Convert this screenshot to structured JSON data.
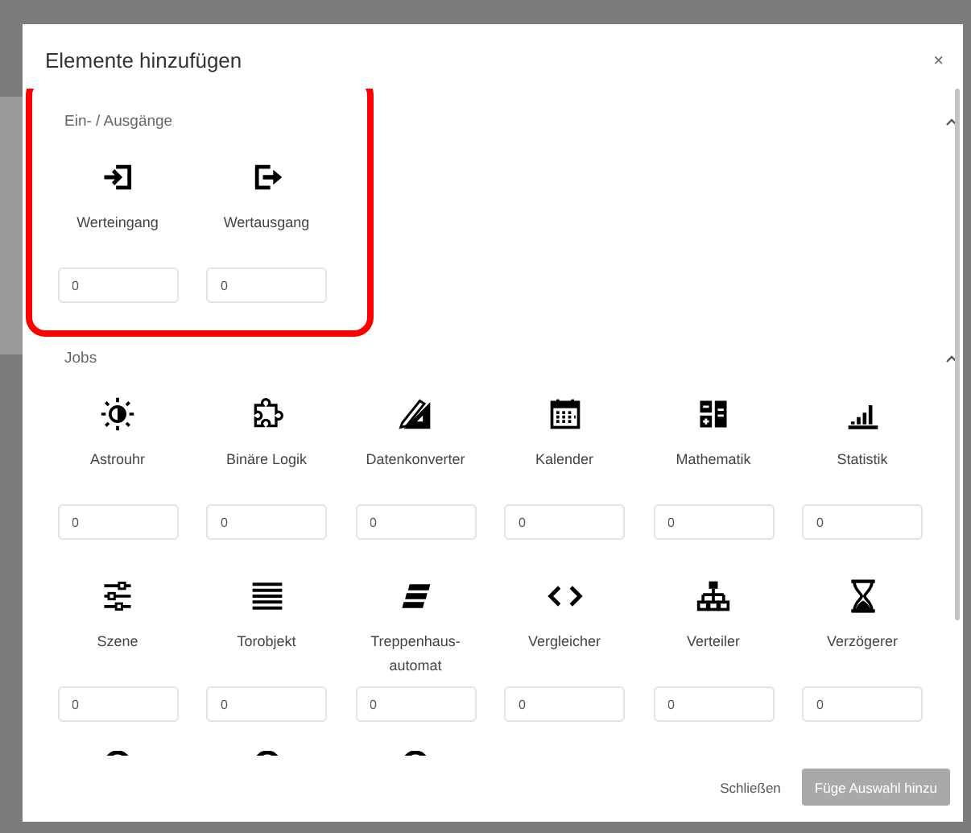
{
  "dialog": {
    "title": "Elemente hinzufügen",
    "close": "×"
  },
  "sections": [
    {
      "title": "Ein- / Ausgänge",
      "expanded": true,
      "highlighted": true,
      "items": [
        {
          "kind": "input",
          "label": "Werteingang",
          "value": "0"
        },
        {
          "kind": "output",
          "label": "Wertausgang",
          "value": "0"
        }
      ]
    },
    {
      "title": "Jobs",
      "expanded": true,
      "highlighted": false,
      "items": [
        {
          "kind": "sun",
          "label": "Astrouhr",
          "value": "0"
        },
        {
          "kind": "puzzle",
          "label": "Binäre Logik",
          "value": "0"
        },
        {
          "kind": "ruler",
          "label": "Datenkonverter",
          "value": "0"
        },
        {
          "kind": "calendar",
          "label": "Kalender",
          "value": "0"
        },
        {
          "kind": "calculator",
          "label": "Mathematik",
          "value": "0"
        },
        {
          "kind": "chart",
          "label": "Statistik",
          "value": "0"
        },
        {
          "kind": "sliders",
          "label": "Szene",
          "value": "0"
        },
        {
          "kind": "lines",
          "label": "Torobjekt",
          "value": "0"
        },
        {
          "kind": "stairs",
          "label": "Treppenhaus-automat",
          "value": "0"
        },
        {
          "kind": "code",
          "label": "Vergleicher",
          "value": "0"
        },
        {
          "kind": "tree",
          "label": "Verteiler",
          "value": "0"
        },
        {
          "kind": "hourglass",
          "label": "Verzögerer",
          "value": "0"
        },
        {
          "kind": "arc"
        },
        {
          "kind": "arc"
        },
        {
          "kind": "arc"
        }
      ]
    }
  ],
  "footer": {
    "buttons": [
      {
        "label": "Schließen",
        "disabled": false,
        "kind": "text"
      },
      {
        "label": "Füge Auswahl hinzu",
        "disabled": true,
        "kind": "raised"
      }
    ]
  }
}
